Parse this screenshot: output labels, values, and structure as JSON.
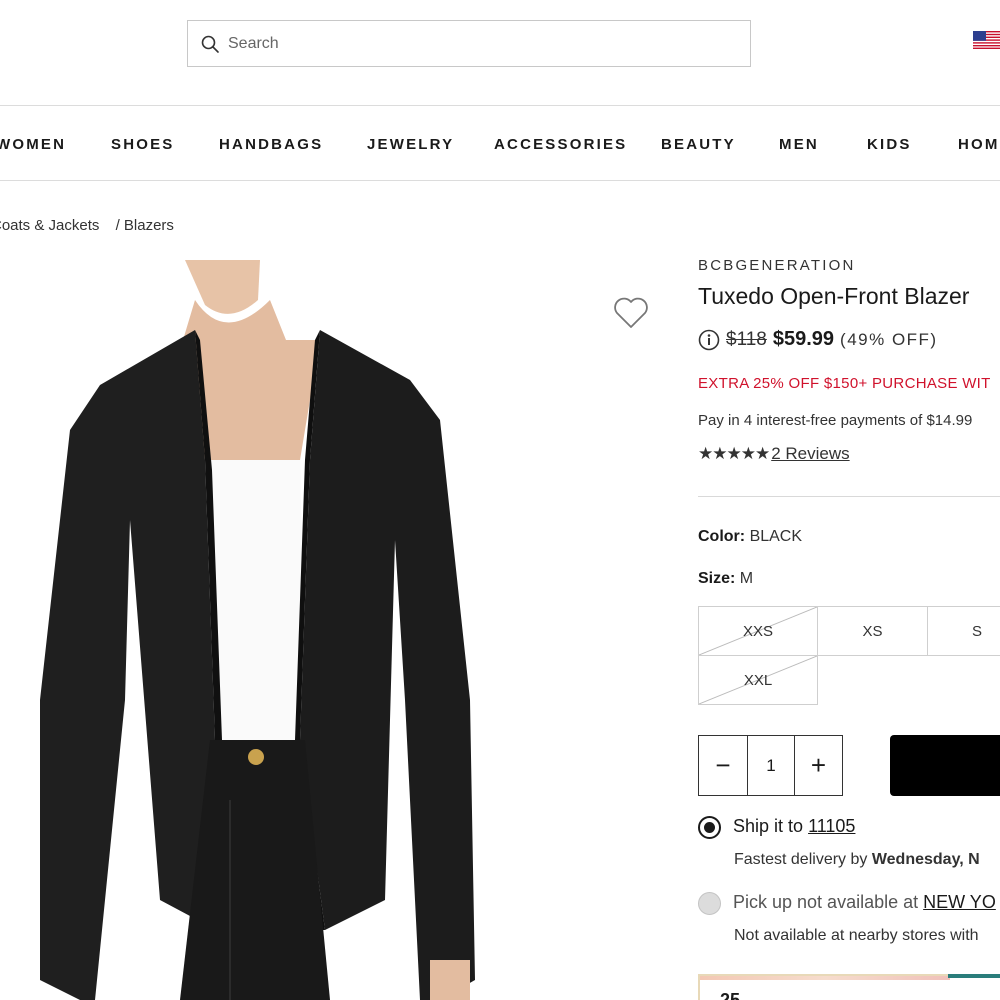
{
  "search": {
    "placeholder": "Search"
  },
  "nav": {
    "items": [
      "WOMEN",
      "SHOES",
      "HANDBAGS",
      "JEWELRY",
      "ACCESSORIES",
      "BEAUTY",
      "MEN",
      "KIDS",
      "HOM"
    ]
  },
  "breadcrumb": {
    "items": [
      "Coats & Jackets",
      "/ Blazers"
    ]
  },
  "product": {
    "brand": "BCBGENERATION",
    "title": "Tuxedo Open-Front Blazer",
    "original_price": "$118",
    "sale_price": "$59.99",
    "discount": "(49% OFF)",
    "promo": "EXTRA 25% OFF $150+ PURCHASE WIT",
    "installments": "Pay in 4 interest-free payments of $14.99",
    "stars": "★★★★★",
    "reviews": "2 Reviews",
    "color_label": "Color:",
    "color_value": "BLACK",
    "size_label": "Size:",
    "size_value": "M",
    "sizes": [
      "XXS",
      "XS",
      "S",
      "XXL"
    ],
    "quantity": "1",
    "minus": "−",
    "plus": "+"
  },
  "shipping": {
    "ship_label": "Ship it to",
    "zip": "11105",
    "fastest_label": "Fastest delivery by",
    "fastest_value": "Wednesday, N",
    "pickup_label": "Pick up not available at",
    "pickup_store": "NEW YO",
    "nearby": "Not available at nearby stores with"
  },
  "banner": {
    "text": "25"
  },
  "colors": {
    "promo": "#d0122c",
    "accent": "#2a7d7b"
  },
  "icons": [
    "search-icon",
    "us-flag-icon",
    "heart-icon",
    "info-icon"
  ]
}
